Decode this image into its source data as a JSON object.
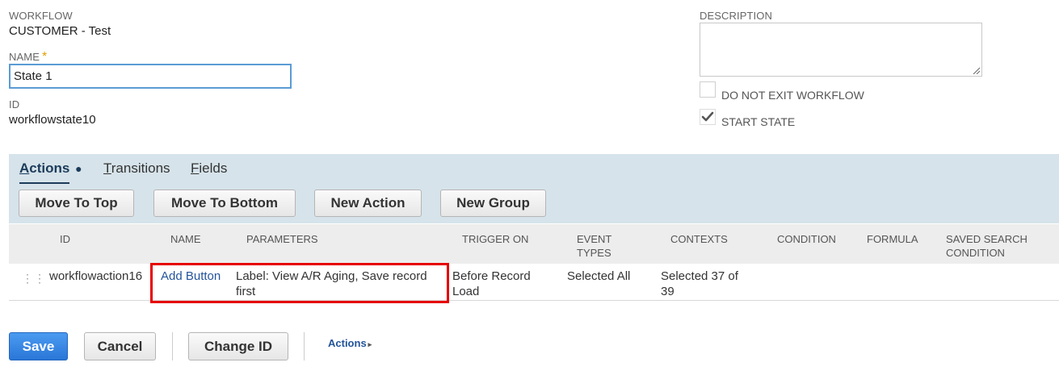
{
  "workflow": {
    "label": "WORKFLOW",
    "value": "CUSTOMER - Test"
  },
  "name": {
    "label": "NAME",
    "required_mark": "*",
    "value": "State 1"
  },
  "id": {
    "label": "ID",
    "value": "workflowstate10"
  },
  "description": {
    "label": "DESCRIPTION",
    "value": ""
  },
  "checkboxes": {
    "do_not_exit": {
      "label": "DO NOT EXIT WORKFLOW",
      "checked": false
    },
    "start_state": {
      "label": "START STATE",
      "checked": true
    }
  },
  "tabs": [
    {
      "label": "Actions",
      "accesskey": "A",
      "rest": "ctions",
      "active": true,
      "dot": "●"
    },
    {
      "label": "Transitions",
      "accesskey": "T",
      "rest": "ransitions",
      "active": false
    },
    {
      "label": "Fields",
      "accesskey": "F",
      "rest": "ields",
      "active": false
    }
  ],
  "action_buttons": {
    "move_to_top": "Move To Top",
    "move_to_bottom": "Move To Bottom",
    "new_action": "New Action",
    "new_group": "New Group"
  },
  "table": {
    "headers": {
      "id": "ID",
      "name": "NAME",
      "parameters": "PARAMETERS",
      "trigger_on": "TRIGGER ON",
      "event_types_1": "EVENT",
      "event_types_2": "TYPES",
      "contexts": "CONTEXTS",
      "condition": "CONDITION",
      "formula": "FORMULA",
      "saved_search_1": "SAVED SEARCH",
      "saved_search_2": "CONDITION"
    },
    "rows": [
      {
        "id": "workflowaction16",
        "name": "Add Button",
        "parameters_1": "Label: View A/R Aging, Save record",
        "parameters_2": "first",
        "trigger_on_1": "Before Record",
        "trigger_on_2": "Load",
        "event_types": "Selected All",
        "contexts_1": "Selected 37 of",
        "contexts_2": "39",
        "condition": "",
        "formula": "",
        "saved_search_condition": ""
      }
    ]
  },
  "footer": {
    "save": "Save",
    "cancel": "Cancel",
    "change_id": "Change ID",
    "actions": "Actions",
    "actions_caret": "▸"
  },
  "colors": {
    "tab_bar_bg": "#d6e3ea",
    "link": "#24549b",
    "primary_button": "#2a76d8",
    "highlight_box": "#e60000",
    "required_star": "#e0a000"
  }
}
